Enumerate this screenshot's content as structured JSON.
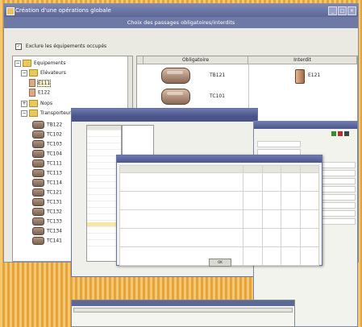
{
  "window": {
    "title": "Création d'une opérations globale",
    "header": "Choix des passages obligatoires/interdits",
    "buttons": [
      "_",
      "□",
      "×"
    ]
  },
  "exclude": {
    "label": "Exclure les équipements occupés",
    "checked": "✓"
  },
  "tree": {
    "root": "Equipements",
    "elevateurs": {
      "label": "Elévateurs",
      "items": [
        "E111",
        "E122"
      ]
    },
    "nops": "Nops",
    "transporteurs": {
      "label": "Transporteurs",
      "items": [
        "TB122",
        "TC102",
        "TC103",
        "TC104",
        "TC111",
        "TC113",
        "TC114",
        "TC121",
        "TC131",
        "TC132",
        "TC133",
        "TC134",
        "TC141"
      ]
    }
  },
  "grid": {
    "col_obligatoire": "Obligatoire",
    "col_interdit": "Interdit",
    "obligatoire": [
      "TB121",
      "TC101"
    ],
    "interdit": [
      "E121"
    ]
  },
  "dialog": {
    "ok": "OK"
  },
  "colors": {
    "titlebar": "#5d6795",
    "banner": "#6f79a5",
    "background_stripe_1": "#f3c86e",
    "background_stripe_2": "#e6a23c"
  }
}
